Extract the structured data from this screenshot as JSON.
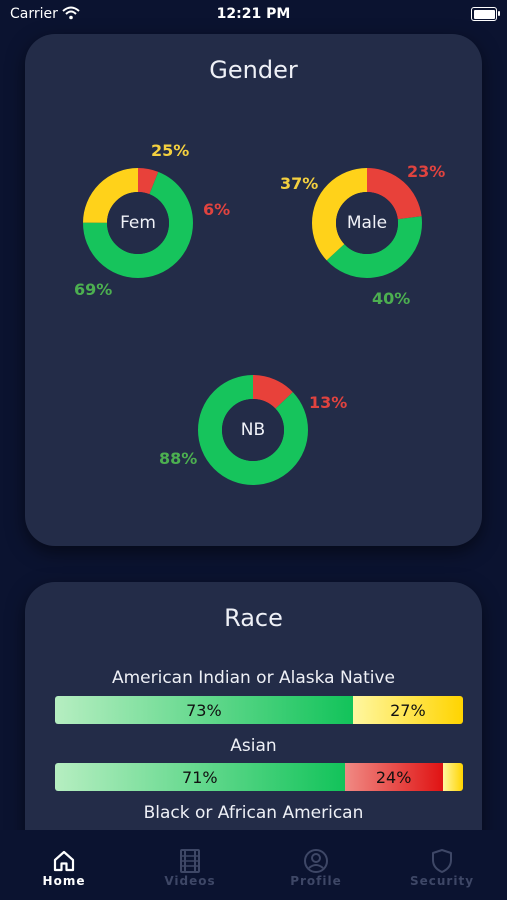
{
  "status_bar": {
    "carrier": "Carrier",
    "time": "12:21 PM"
  },
  "gender": {
    "title": "Gender",
    "charts": [
      {
        "label": "Fem",
        "segments": [
          {
            "pct": 69,
            "label": "69%",
            "color": "green"
          },
          {
            "pct": 25,
            "label": "25%",
            "color": "yellow"
          },
          {
            "pct": 6,
            "label": "6%",
            "color": "red"
          }
        ]
      },
      {
        "label": "Male",
        "segments": [
          {
            "pct": 40,
            "label": "40%",
            "color": "green"
          },
          {
            "pct": 37,
            "label": "37%",
            "color": "yellow"
          },
          {
            "pct": 23,
            "label": "23%",
            "color": "red"
          }
        ]
      },
      {
        "label": "NB",
        "segments": [
          {
            "pct": 88,
            "label": "88%",
            "color": "green"
          },
          {
            "pct": 13,
            "label": "13%",
            "color": "red"
          }
        ]
      }
    ]
  },
  "race": {
    "title": "Race",
    "rows": [
      {
        "label": "American Indian or Alaska Native",
        "segments": [
          {
            "pct": 73,
            "label": "73%",
            "color": "green"
          },
          {
            "pct": 27,
            "label": "27%",
            "color": "yellow"
          }
        ]
      },
      {
        "label": "Asian",
        "segments": [
          {
            "pct": 71,
            "label": "71%",
            "color": "green"
          },
          {
            "pct": 24,
            "label": "24%",
            "color": "red"
          },
          {
            "pct": 5,
            "label": "",
            "color": "yellow"
          }
        ]
      },
      {
        "label": "Black or African American"
      }
    ]
  },
  "tabs": [
    {
      "label": "Home",
      "icon": "home-icon",
      "active": true
    },
    {
      "label": "Videos",
      "icon": "film-icon",
      "active": false
    },
    {
      "label": "Profile",
      "icon": "user-circle-icon",
      "active": false
    },
    {
      "label": "Security",
      "icon": "shield-icon",
      "active": false
    }
  ],
  "colors": {
    "background": "#0b1330",
    "card": "#232c48",
    "green": "#12c35a",
    "yellow": "#ffd400",
    "red": "#e01313",
    "label_green": "#4caf50",
    "label_yellow": "#f4d03f",
    "label_red": "#e0433f"
  }
}
